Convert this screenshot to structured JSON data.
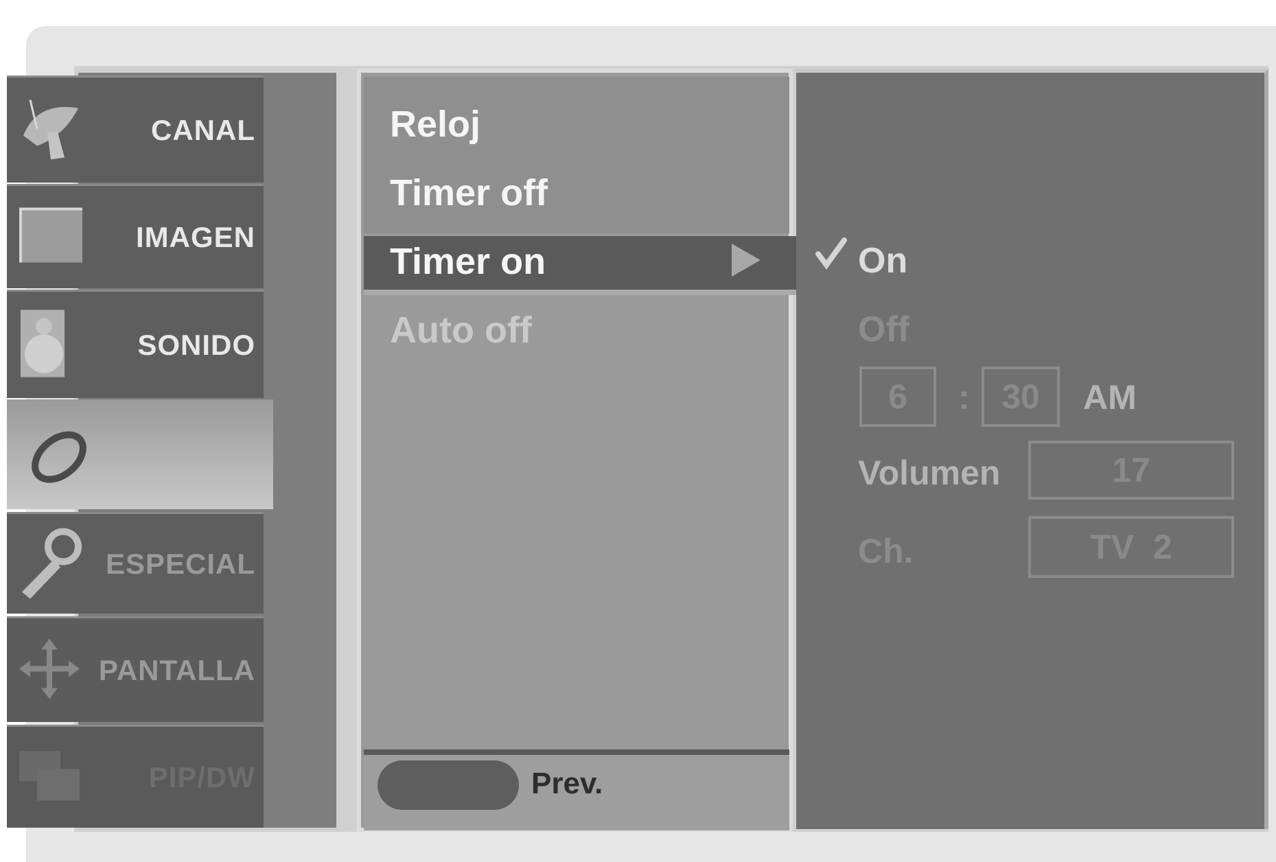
{
  "sidebar": {
    "items": [
      {
        "label": "CANAL",
        "icon": "satellite-dish-icon"
      },
      {
        "label": "IMAGEN",
        "icon": "picture-icon"
      },
      {
        "label": "SONIDO",
        "icon": "speaker-icon"
      },
      {
        "label": "",
        "icon": "clock-ring-icon"
      },
      {
        "label": "ESPECIAL",
        "icon": "key-icon"
      },
      {
        "label": "PANTALLA",
        "icon": "move-arrows-icon"
      },
      {
        "label": "PIP/DW",
        "icon": "pip-icon"
      }
    ]
  },
  "submenu": {
    "items": [
      "Reloj",
      "Timer off",
      "Timer on",
      "Auto off"
    ],
    "selected": "Timer on",
    "footer_label": "Prev."
  },
  "timer_on": {
    "on_label": "On",
    "off_label": "Off",
    "hour": "6",
    "separator": ":",
    "minute": "30",
    "ampm": "AM",
    "volume_label": "Volumen",
    "volume_value": "17",
    "channel_label": "Ch.",
    "channel_value": "TV  2"
  }
}
